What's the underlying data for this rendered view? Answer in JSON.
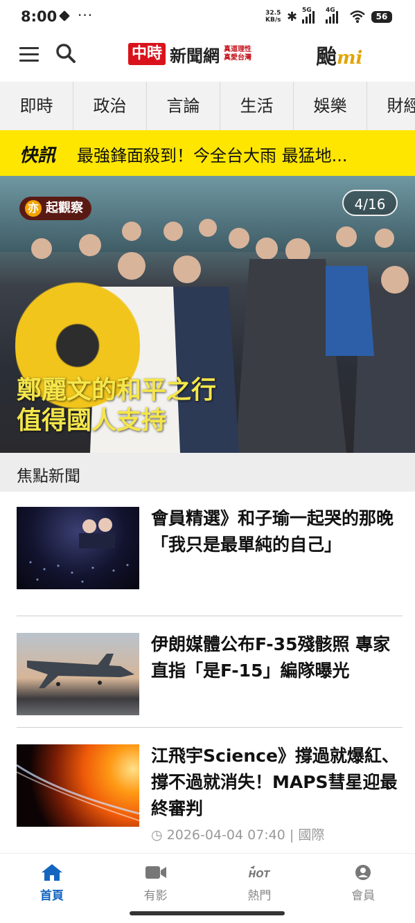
{
  "status_bar": {
    "time": "8:00",
    "more": "···",
    "net_speed_value": "32.5",
    "net_speed_unit": "KB/s",
    "sim1": "5G",
    "sim2": "4G",
    "battery": "56"
  },
  "header": {
    "logo_red": "中時",
    "logo_text": "新聞網",
    "logo_tagline_1": "真道理性",
    "logo_tagline_2": "真愛台灣",
    "brand_right": "颱",
    "brand_right_suffix": "mi"
  },
  "tabs": [
    "即時",
    "政治",
    "言論",
    "生活",
    "娛樂",
    "財經"
  ],
  "breaking": {
    "label": "快訊",
    "text": "最強鋒面殺到！今全台大雨 最猛地..."
  },
  "hero": {
    "badge": "起觀察",
    "badge_icon": "亦",
    "counter": "4/16",
    "headline_line1": "鄭麗文的和平之行",
    "headline_line2": "值得國人支持"
  },
  "section": {
    "title": "焦點新聞"
  },
  "news": [
    {
      "title": "會員精選》和子瑜一起哭的那晚 「我只是最單純的自己」"
    },
    {
      "title": "伊朗媒體公布F-35殘骸照 專家直指「是F-15」編隊曝光"
    },
    {
      "title": "江飛宇Science》撐過就爆紅、撐不過就消失！MAPS彗星迎最終審判",
      "date": "2026-04-04 07:40",
      "category": "國際"
    }
  ],
  "bottom_nav": [
    {
      "label": "首頁",
      "icon": "home-icon",
      "active": true
    },
    {
      "label": "有影",
      "icon": "video-icon",
      "active": false
    },
    {
      "label": "熱門",
      "icon": "hot-icon",
      "active": false
    },
    {
      "label": "會員",
      "icon": "member-icon",
      "active": false
    }
  ],
  "colors": {
    "brand_red": "#d9131b",
    "breaking_yellow": "#ffe600",
    "headline_yellow": "#f5e64a",
    "active_blue": "#1565c0"
  }
}
